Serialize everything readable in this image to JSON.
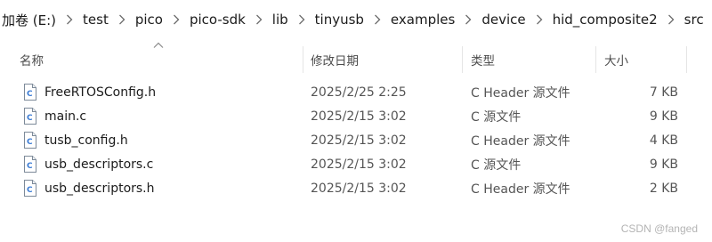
{
  "breadcrumb": [
    "加卷 (E:)",
    "test",
    "pico",
    "pico-sdk",
    "lib",
    "tinyusb",
    "examples",
    "device",
    "hid_composite2",
    "src"
  ],
  "columns": {
    "name": "名称",
    "date": "修改日期",
    "type": "类型",
    "size": "大小"
  },
  "files": [
    {
      "name": "FreeRTOSConfig.h",
      "date": "2025/2/25 2:25",
      "type": "C Header 源文件",
      "size": "7 KB",
      "icon": "c-header-file-icon"
    },
    {
      "name": "main.c",
      "date": "2025/2/15 3:02",
      "type": "C 源文件",
      "size": "9 KB",
      "icon": "c-source-file-icon"
    },
    {
      "name": "tusb_config.h",
      "date": "2025/2/15 3:02",
      "type": "C Header 源文件",
      "size": "4 KB",
      "icon": "c-header-file-icon"
    },
    {
      "name": "usb_descriptors.c",
      "date": "2025/2/15 3:02",
      "type": "C 源文件",
      "size": "9 KB",
      "icon": "c-source-file-icon"
    },
    {
      "name": "usb_descriptors.h",
      "date": "2025/2/15 3:02",
      "type": "C Header 源文件",
      "size": "2 KB",
      "icon": "c-header-file-icon"
    }
  ],
  "watermark": "CSDN @fanged"
}
